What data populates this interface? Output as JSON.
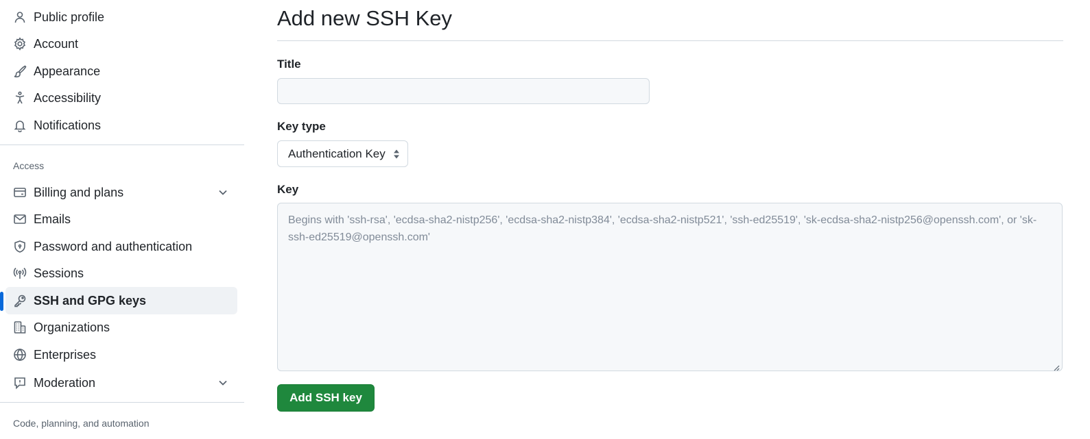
{
  "sidebar": {
    "items": [
      {
        "label": "Public profile"
      },
      {
        "label": "Account"
      },
      {
        "label": "Appearance"
      },
      {
        "label": "Accessibility"
      },
      {
        "label": "Notifications"
      },
      {
        "label": "Billing and plans"
      },
      {
        "label": "Emails"
      },
      {
        "label": "Password and authentication"
      },
      {
        "label": "Sessions"
      },
      {
        "label": "SSH and GPG keys",
        "active": true
      },
      {
        "label": "Organizations"
      },
      {
        "label": "Enterprises"
      },
      {
        "label": "Moderation"
      }
    ],
    "sections": {
      "access": "Access",
      "code": "Code, planning, and automation"
    }
  },
  "main": {
    "title": "Add new SSH Key",
    "title_field": {
      "label": "Title",
      "value": "",
      "placeholder": ""
    },
    "key_type": {
      "label": "Key type",
      "selected": "Authentication Key"
    },
    "key_field": {
      "label": "Key",
      "value": "",
      "placeholder": "Begins with 'ssh-rsa', 'ecdsa-sha2-nistp256', 'ecdsa-sha2-nistp384', 'ecdsa-sha2-nistp521', 'ssh-ed25519', 'sk-ecdsa-sha2-nistp256@openssh.com', or 'sk-ssh-ed25519@openssh.com'"
    },
    "submit_label": "Add SSH key"
  },
  "colors": {
    "accent": "#0969da",
    "primary_button": "#1f883d",
    "active_item_bg": "#eff2f5"
  }
}
